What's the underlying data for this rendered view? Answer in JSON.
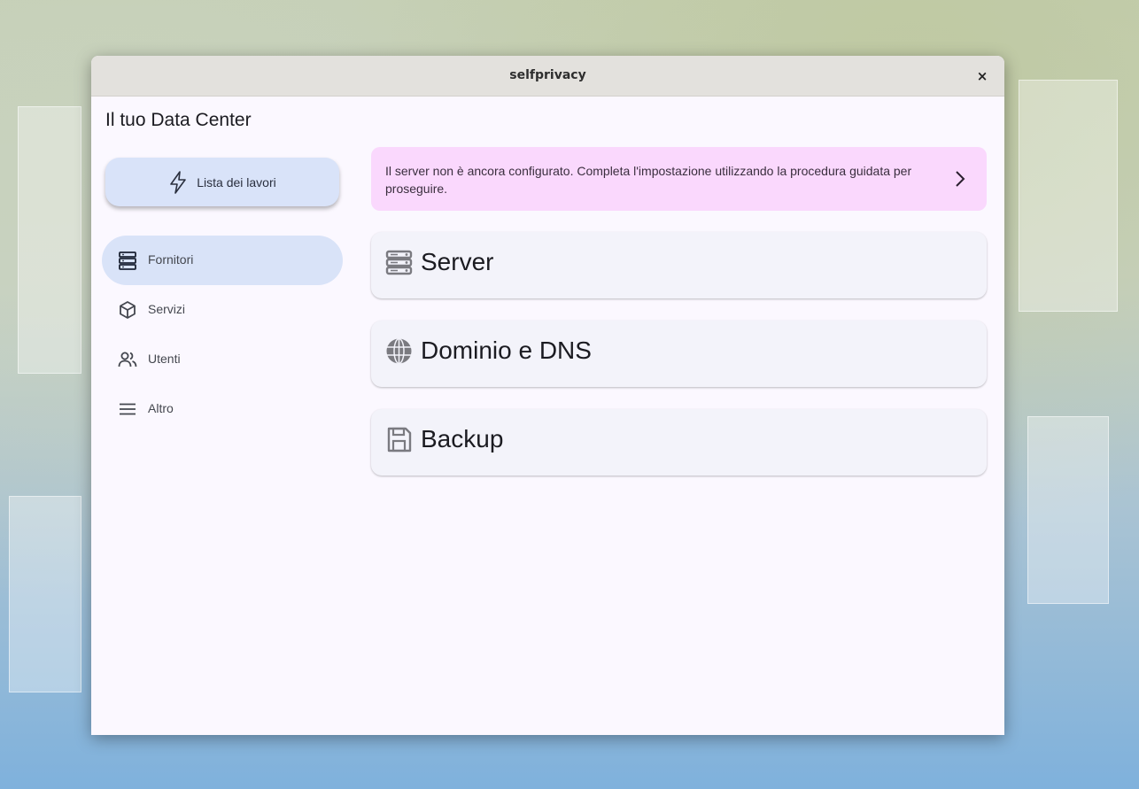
{
  "window": {
    "title": "selfprivacy",
    "close_glyph": "×"
  },
  "app": {
    "title": "Il tuo Data Center"
  },
  "jobs_button": {
    "label": "Lista dei lavori",
    "icon": "lightning-icon"
  },
  "nav": {
    "items": [
      {
        "label": "Fornitori",
        "icon": "server-stack-icon",
        "active": true
      },
      {
        "label": "Servizi",
        "icon": "cube-icon",
        "active": false
      },
      {
        "label": "Utenti",
        "icon": "users-icon",
        "active": false
      },
      {
        "label": "Altro",
        "icon": "menu-icon",
        "active": false
      }
    ]
  },
  "banner": {
    "text": "Il server non è ancora configurato. Completa l'impostazione utilizzando la procedura guidata per proseguire.",
    "icon": "chevron-right-icon"
  },
  "cards": [
    {
      "title": "Server",
      "icon": "server-icon"
    },
    {
      "title": "Dominio e DNS",
      "icon": "globe-icon"
    },
    {
      "title": "Backup",
      "icon": "save-icon"
    }
  ],
  "colors": {
    "window_bg": "#fbf8ff",
    "titlebar_bg": "#e3e1dd",
    "jobs_button_bg": "#d9e3f9",
    "nav_active_bg": "#d9e3f8",
    "banner_bg": "#fad8fd",
    "card_bg": "#f3f3fa"
  }
}
